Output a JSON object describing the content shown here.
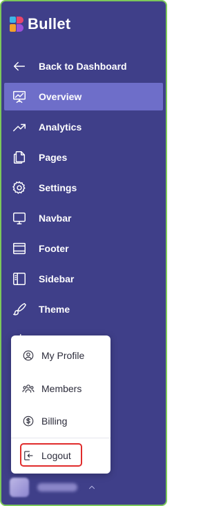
{
  "brand": {
    "name": "Bullet"
  },
  "nav": {
    "items": [
      {
        "label": "Back to Dashboard",
        "icon": "arrow-left-icon"
      },
      {
        "label": "Overview",
        "icon": "presentation-chart-icon",
        "active": true
      },
      {
        "label": "Analytics",
        "icon": "trending-up-icon"
      },
      {
        "label": "Pages",
        "icon": "pages-icon"
      },
      {
        "label": "Settings",
        "icon": "gear-icon"
      },
      {
        "label": "Navbar",
        "icon": "monitor-icon"
      },
      {
        "label": "Footer",
        "icon": "footer-layout-icon"
      },
      {
        "label": "Sidebar",
        "icon": "sidebar-layout-icon"
      },
      {
        "label": "Theme",
        "icon": "brush-icon"
      },
      {
        "label": "",
        "icon": "code-icon"
      }
    ]
  },
  "account_menu": {
    "items": [
      {
        "label": "My Profile",
        "icon": "user-circle-icon"
      },
      {
        "label": "Members",
        "icon": "users-icon"
      },
      {
        "label": "Billing",
        "icon": "dollar-circle-icon"
      },
      {
        "label": "Logout",
        "icon": "logout-icon",
        "highlighted": true
      }
    ]
  },
  "colors": {
    "sidebar_bg": "#3f3f89",
    "active_bg": "#6e6ec9",
    "highlight_border": "#e02b2b",
    "frame_border": "#7cc85a"
  }
}
